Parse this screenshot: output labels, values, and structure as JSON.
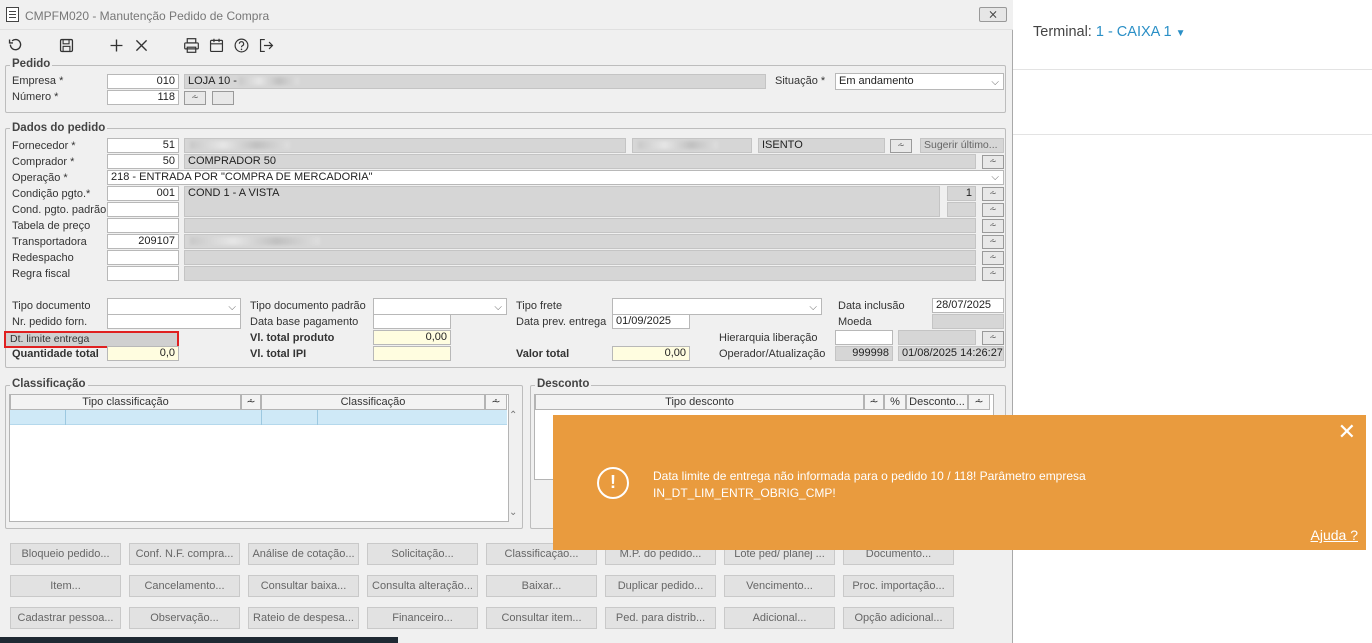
{
  "window": {
    "title": "CMPFM020 - Manutenção Pedido de Compra",
    "close": "⨯"
  },
  "terminal": {
    "label": "Terminal:",
    "value": "1 - CAIXA 1"
  },
  "pedido": {
    "legend": "Pedido",
    "empresa_label": "Empresa *",
    "empresa_code": "010",
    "empresa_name": "LOJA 10 -",
    "numero_label": "Número *",
    "numero": "118",
    "situacao_label": "Situação *",
    "situacao": "Em andamento"
  },
  "dados": {
    "legend": "Dados do pedido",
    "fornecedor_label": "Fornecedor *",
    "fornecedor_code": "51",
    "isento": "ISENTO",
    "sugerir": "Sugerir último...",
    "comprador_label": "Comprador *",
    "comprador_code": "50",
    "comprador_name": "COMPRADOR 50",
    "operacao_label": "Operação *",
    "operacao": "218 - ENTRADA POR \"COMPRA DE MERCADORIA\"",
    "condicao_label": "Condição pgto.*",
    "condicao_code": "001",
    "condicao_name": "COND 1 - A VISTA",
    "condicao_n": "1",
    "cond_padrao_label": "Cond. pgto. padrão",
    "tabela_label": "Tabela de preço",
    "transportadora_label": "Transportadora",
    "transportadora_code": "209107",
    "redespacho_label": "Redespacho",
    "regra_label": "Regra fiscal",
    "tipo_doc_label": "Tipo documento",
    "tipo_doc_padrao_label": "Tipo documento padrão",
    "tipo_frete_label": "Tipo frete",
    "data_inclusao_label": "Data inclusão",
    "data_inclusao": "28/07/2025",
    "nr_pedido_label": "Nr. pedido forn.",
    "data_base_label": "Data base pagamento",
    "data_prev_label": "Data prev. entrega",
    "data_prev": "01/09/2025",
    "moeda_label": "Moeda",
    "dt_limite_label": "Dt. limite entrega",
    "vl_prod_label": "Vl. total produto",
    "vl_prod": "0,00",
    "hierarquia_label": "Hierarquia liberação",
    "qtd_label": "Quantidade total",
    "qtd": "0,0",
    "vl_ipi_label": "Vl. total IPI",
    "valor_total_label": "Valor total",
    "valor_total": "0,00",
    "operador_label": "Operador/Atualização",
    "operador": "999998",
    "atualizacao": "01/08/2025 14:26:27"
  },
  "classificacao": {
    "legend": "Classificação",
    "col1": "Tipo classificação",
    "col2": "Classificação"
  },
  "desconto": {
    "legend": "Desconto",
    "col1": "Tipo desconto",
    "col2": "%",
    "col3": "Desconto..."
  },
  "buttons": {
    "row1": [
      "Bloqueio pedido...",
      "Conf. N.F. compra...",
      "Análise de cotação...",
      "Solicitação...",
      "Classificação...",
      "M.P. do pedido...",
      "Lote ped/ planej ...",
      "Documento..."
    ],
    "row2": [
      "Item...",
      "Cancelamento...",
      "Consultar baixa...",
      "Consulta alteração...",
      "Baixar...",
      "Duplicar pedido...",
      "Vencimento...",
      "Proc. importação..."
    ],
    "row3": [
      "Cadastrar pessoa...",
      "Observação...",
      "Rateio de despesa...",
      "Financeiro...",
      "Consultar item...",
      "Ped. para distrib...",
      "Adicional...",
      "Opção adicional..."
    ]
  },
  "toast": {
    "message": "Data limite de entrega não informada para o pedido 10 / 118! Parâmetro empresa IN_DT_LIM_ENTR_OBRIG_CMP!",
    "help": "Ajuda ?",
    "close": "✕",
    "icon": "exclamation-icon"
  },
  "colors": {
    "toast": "#e99b3e",
    "highlight": "#e02020",
    "link": "#2a8fc6"
  }
}
